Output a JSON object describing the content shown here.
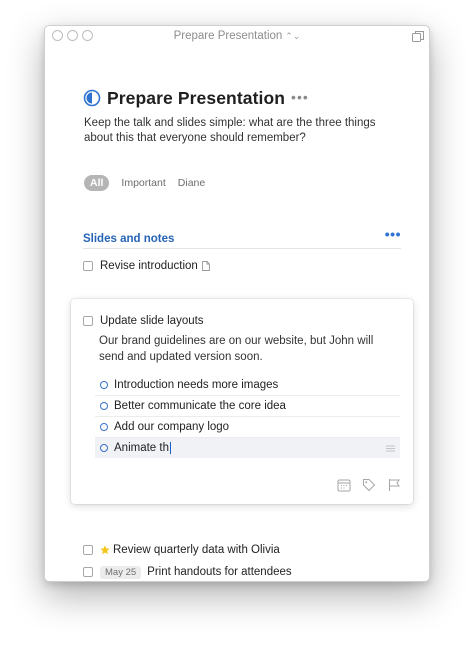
{
  "window": {
    "title": "Prepare Presentation",
    "title_indicator": "⌃⌄"
  },
  "project": {
    "title": "Prepare Presentation",
    "more_label": "•••",
    "notes": "Keep the talk and slides simple: what are the three things about this that everyone should remember?"
  },
  "tags": [
    {
      "label": "All",
      "active": true
    },
    {
      "label": "Important",
      "active": false
    },
    {
      "label": "Diane",
      "active": false
    }
  ],
  "heading": {
    "title": "Slides and notes",
    "more_label": "•••"
  },
  "tasks": {
    "revise": {
      "title": "Revise introduction"
    },
    "update": {
      "title": "Update slide layouts",
      "notes": "Our brand guidelines are on our website, but John will send and updated version soon.",
      "checklist": [
        {
          "text": "Introduction needs more images"
        },
        {
          "text": "Better communicate the core idea"
        },
        {
          "text": "Add our company logo"
        },
        {
          "text": "Animate th"
        }
      ]
    },
    "review": {
      "title": "Review quarterly data with Olivia"
    },
    "print": {
      "title": "Print handouts for attendees",
      "date": "May 25"
    }
  },
  "colors": {
    "accent": "#2e73d1",
    "heading": "#2764b5",
    "star": "#f5c518"
  },
  "icons": {
    "project": "progress-pie-icon",
    "note": "note-icon",
    "when": "calendar-icon",
    "tag": "tag-icon",
    "deadline": "flag-icon",
    "star": "star-icon"
  }
}
